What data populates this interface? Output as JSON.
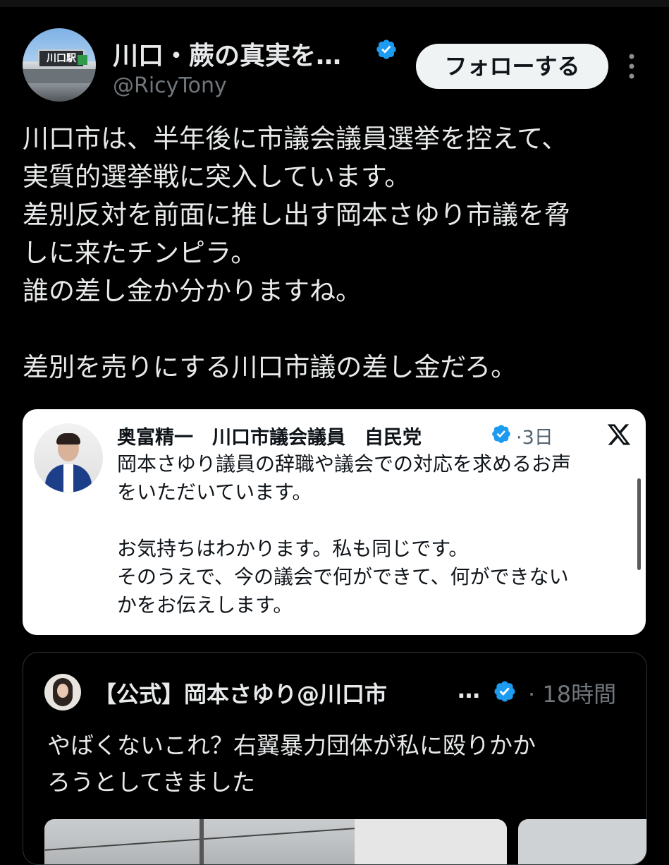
{
  "author": {
    "display_name": "川口・蕨の真実を…",
    "handle": "@RicyTony",
    "avatar_icon": "station-photo-avatar",
    "avatar_sign_text": "川口駅",
    "verified_icon": "verified-badge-icon",
    "verified_color": "#1d9bf0"
  },
  "actions": {
    "follow_label": "フォローする",
    "more_icon": "more-vertical-icon"
  },
  "tweet": {
    "text": "川口市は、半年後に市議会議員選挙を控えて、\n実質的選挙戦に突入しています。\n差別反対を前面に推し出す岡本さゆり市議を脅\nしに来たチンピラ。\n誰の差し金か分かりますね。\n\n差別を売りにする川口市議の差し金だろ。"
  },
  "quote1": {
    "author": "奥富精一　川口市議会議員　自民党",
    "time": "·3日",
    "platform_icon": "x-logo-icon",
    "text": "岡本さゆり議員の辞職や議会での対応を求めるお声\nをいただいています。\n\nお気持ちはわかります。私も同じです。\nそのうえで、今の議会で何ができて、何ができない\nかをお伝えします。"
  },
  "quote2": {
    "author": "【公式】岡本さゆり@川口市",
    "ellipsis": "…",
    "time": "· 18時間",
    "text": "やばくないこれ？右翼暴力団体が私に殴りかか\nろうとしてきました"
  },
  "colors": {
    "background": "#000000",
    "text_primary": "#e7e9ea",
    "text_secondary": "#71767b",
    "button_bg": "#eff3f4"
  }
}
